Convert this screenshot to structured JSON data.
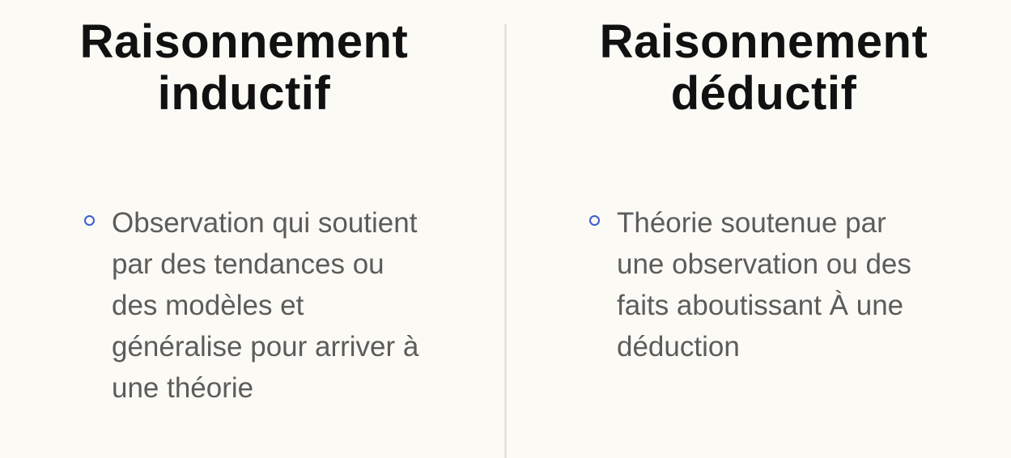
{
  "left_column": {
    "heading_line1": "Raisonnement",
    "heading_line2": "inductif",
    "bullet_lines": [
      "Observation qui soutient",
      "par des tendances ou",
      "des modèles et",
      "généralise pour arriver à",
      "une théorie"
    ]
  },
  "right_column": {
    "heading_line1": "Raisonnement",
    "heading_line2": "déductif",
    "bullet_lines": [
      "Théorie soutenue par",
      "une observation ou des",
      "faits aboutissant À une",
      "déduction"
    ]
  },
  "colors": {
    "background": "#fbfaf5",
    "heading": "#111111",
    "body_text": "#5c5c5c",
    "bullet_accent": "#3d5bd1",
    "divider": "#e6e4df"
  }
}
